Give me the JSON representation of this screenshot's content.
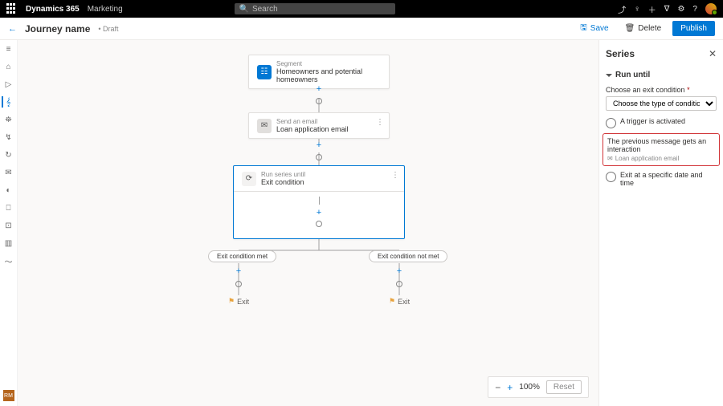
{
  "topbar": {
    "app": "Dynamics 365",
    "module": "Marketing",
    "search_placeholder": "Search"
  },
  "header": {
    "title": "Journey name",
    "status": "• Draft",
    "save": "Save",
    "delete": "Delete",
    "publish": "Publish"
  },
  "rail": {
    "rm": "RM"
  },
  "nodes": {
    "segment": {
      "label": "Segment",
      "value": "Homeowners and potential homeowners"
    },
    "email": {
      "label": "Send an email",
      "value": "Loan application email"
    },
    "series": {
      "label": "Run series until",
      "value": "Exit condition"
    }
  },
  "branches": {
    "met": "Exit condition met",
    "notmet": "Exit condition not met",
    "exit": "Exit"
  },
  "panel": {
    "title": "Series",
    "section": "Run until",
    "choose_label": "Choose an exit condition",
    "choose_placeholder": "Choose the type of condition",
    "opt1": "A trigger is activated",
    "opt2": "The previous message gets an interaction",
    "opt2_sub": "Loan application email",
    "opt3": "Exit at a specific date and time"
  },
  "zoom": {
    "level": "100%",
    "reset": "Reset"
  }
}
